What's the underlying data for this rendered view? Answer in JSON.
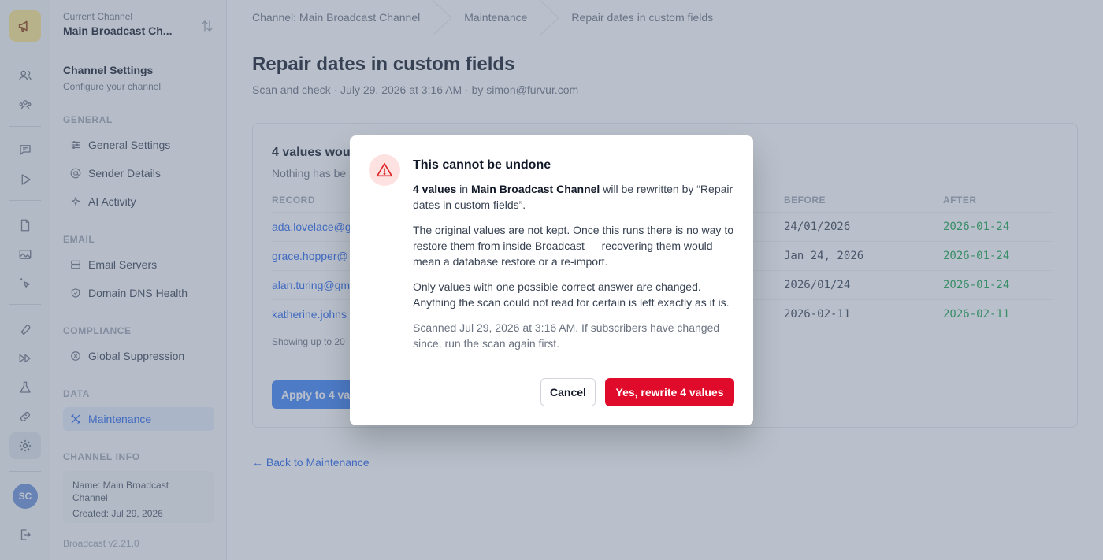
{
  "rail": {
    "icons": [
      "megaphone-icon",
      "users-icon",
      "team-icon",
      "chat-icon",
      "play-icon",
      "document-icon",
      "image-icon",
      "pointer-icon",
      "wrench-icon",
      "fast-forward-icon",
      "flask-icon",
      "link-icon",
      "gear-icon",
      "logout-icon"
    ],
    "avatar_initials": "SC"
  },
  "sidebar": {
    "channel_label": "Current Channel",
    "channel_name": "Main Broadcast Ch...",
    "title": "Channel Settings",
    "subtitle": "Configure your channel",
    "sections": {
      "general": "GENERAL",
      "email": "EMAIL",
      "compliance": "COMPLIANCE",
      "data": "DATA",
      "channel_info": "CHANNEL INFO"
    },
    "items": {
      "general_settings": "General Settings",
      "sender_details": "Sender Details",
      "ai_activity": "AI Activity",
      "email_servers": "Email Servers",
      "domain_dns_health": "Domain DNS Health",
      "global_suppression": "Global Suppression",
      "maintenance": "Maintenance"
    },
    "info": {
      "name_line1": "Name: Main Broadcast",
      "name_line2": "Channel",
      "created": "Created: Jul 29, 2026"
    },
    "version": "Broadcast v2.21.0"
  },
  "breadcrumb": [
    "Channel: Main Broadcast Channel",
    "Maintenance",
    "Repair dates in custom fields"
  ],
  "page": {
    "title": "Repair dates in custom fields",
    "subtitle": "Scan and check · July 29, 2026 at 3:16 AM · by simon@furvur.com"
  },
  "card": {
    "title": "4 values wou",
    "subtitle": "Nothing has be",
    "columns": {
      "record": "RECORD",
      "before": "BEFORE",
      "after": "AFTER"
    },
    "rows": [
      {
        "record": "ada.lovelace@g",
        "before": "24/01/2026",
        "after": "2026-01-24"
      },
      {
        "record": "grace.hopper@",
        "before": "Jan 24, 2026",
        "after": "2026-01-24"
      },
      {
        "record": "alan.turing@gm",
        "before": "2026/01/24",
        "after": "2026-01-24"
      },
      {
        "record": "katherine.johns",
        "before": "2026-02-11",
        "after": "2026-02-11"
      }
    ],
    "showing": "Showing up to 20",
    "apply_label": "Apply to 4 va"
  },
  "back_link": "← Back to Maintenance",
  "modal": {
    "title": "This cannot be undone",
    "p1_count": "4 values",
    "p1_in": " in ",
    "p1_channel": "Main Broadcast Channel",
    "p1_rest": " will be rewritten by “Repair dates in custom fields”.",
    "p2": "The original values are not kept. Once this runs there is no way to restore them from inside Broadcast — recovering them would mean a database restore or a re-import.",
    "p3": "Only values with one possible correct answer are changed. Anything the scan could not read for certain is left exactly as it is.",
    "p4": "Scanned Jul 29, 2026 at 3:16 AM. If subscribers have changed since, run the scan again first.",
    "cancel": "Cancel",
    "confirm": "Yes, rewrite 4 values",
    "warning_icon": "warning-triangle-icon"
  },
  "colors": {
    "accent": "#2563eb",
    "danger": "#e00b2a",
    "success": "#16a34a",
    "logo_bg": "#fde68a"
  }
}
